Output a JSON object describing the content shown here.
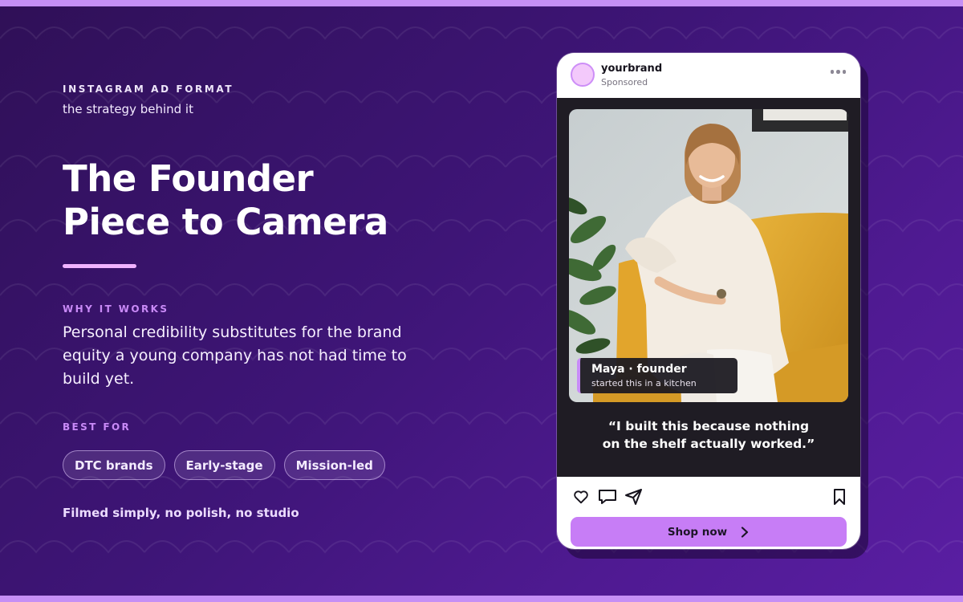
{
  "info": {
    "eyebrow": "INSTAGRAM AD FORMAT",
    "subtitle": "the strategy behind it",
    "headline_line1": "The Founder",
    "headline_line2": "Piece to Camera",
    "why_label": "WHY IT WORKS",
    "why_body": "Personal credibility substitutes for the brand equity a young company has not had time to build yet.",
    "best_label": "BEST FOR",
    "chips": [
      "DTC brands",
      "Early-stage",
      "Mission-led"
    ],
    "footnote": "Filmed simply, no polish, no studio"
  },
  "post": {
    "brand": "yourbrand",
    "sponsored": "Sponsored",
    "caption_name": "Maya · founder",
    "caption_sub": "started this in a kitchen",
    "quote_line1": "“I built this because nothing",
    "quote_line2": "on the shelf actually worked.”",
    "cta_label": "Shop now",
    "icons": [
      "more-icon",
      "heart-icon",
      "comment-icon",
      "share-icon",
      "bookmark-icon",
      "chevron-right-icon"
    ]
  },
  "colors": {
    "background": "#3e1577",
    "accent": "#c77df6",
    "accent_light": "#f0b3ff",
    "top_bottom_bar": "#c58ff5",
    "media_background": "#1f1c24"
  }
}
